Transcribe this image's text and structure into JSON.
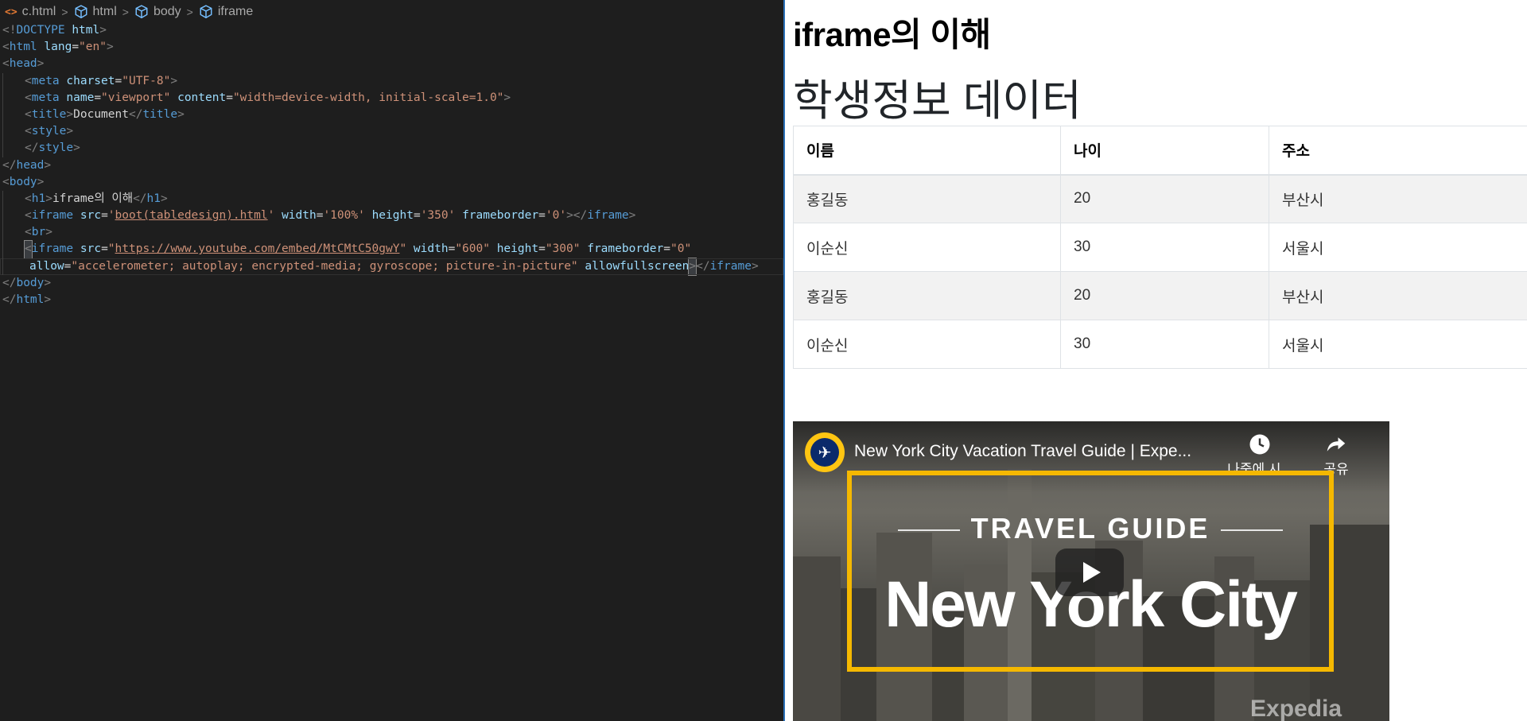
{
  "breadcrumb": {
    "file": "c.html",
    "file_icon": "<>",
    "items": [
      "html",
      "body",
      "iframe"
    ],
    "separator": ">"
  },
  "code_lines": [
    {
      "segments": [
        [
          "<!",
          "t-punc"
        ],
        [
          "DOCTYPE",
          "t-dt"
        ],
        [
          " ",
          "t-text"
        ],
        [
          "html",
          "t-attr"
        ],
        [
          ">",
          "t-punc"
        ]
      ]
    },
    {
      "segments": [
        [
          "<",
          "t-punc"
        ],
        [
          "html",
          "t-tag"
        ],
        [
          " ",
          "t-text"
        ],
        [
          "lang",
          "t-attr"
        ],
        [
          "=",
          "t-text"
        ],
        [
          "\"en\"",
          "t-str"
        ],
        [
          ">",
          "t-punc"
        ]
      ]
    },
    {
      "segments": [
        [
          "<",
          "t-punc"
        ],
        [
          "head",
          "t-tag"
        ],
        [
          ">",
          "t-punc"
        ]
      ]
    },
    {
      "indent": 1,
      "segments": [
        [
          "<",
          "t-punc"
        ],
        [
          "meta",
          "t-tag"
        ],
        [
          " ",
          "t-text"
        ],
        [
          "charset",
          "t-attr"
        ],
        [
          "=",
          "t-text"
        ],
        [
          "\"UTF-8\"",
          "t-str"
        ],
        [
          ">",
          "t-punc"
        ]
      ]
    },
    {
      "indent": 1,
      "segments": [
        [
          "<",
          "t-punc"
        ],
        [
          "meta",
          "t-tag"
        ],
        [
          " ",
          "t-text"
        ],
        [
          "name",
          "t-attr"
        ],
        [
          "=",
          "t-text"
        ],
        [
          "\"viewport\"",
          "t-str"
        ],
        [
          " ",
          "t-text"
        ],
        [
          "content",
          "t-attr"
        ],
        [
          "=",
          "t-text"
        ],
        [
          "\"width=device-width, initial-scale=1.0\"",
          "t-str"
        ],
        [
          ">",
          "t-punc"
        ]
      ]
    },
    {
      "indent": 1,
      "segments": [
        [
          "<",
          "t-punc"
        ],
        [
          "title",
          "t-tag"
        ],
        [
          ">",
          "t-punc"
        ],
        [
          "Document",
          "t-text"
        ],
        [
          "</",
          "t-punc"
        ],
        [
          "title",
          "t-tag"
        ],
        [
          ">",
          "t-punc"
        ]
      ]
    },
    {
      "indent": 1,
      "segments": [
        [
          "<",
          "t-punc"
        ],
        [
          "style",
          "t-tag"
        ],
        [
          ">",
          "t-punc"
        ]
      ]
    },
    {
      "indent": 1,
      "segments": [
        [
          "</",
          "t-punc"
        ],
        [
          "style",
          "t-tag"
        ],
        [
          ">",
          "t-punc"
        ]
      ]
    },
    {
      "segments": [
        [
          "</",
          "t-punc"
        ],
        [
          "head",
          "t-tag"
        ],
        [
          ">",
          "t-punc"
        ]
      ]
    },
    {
      "segments": [
        [
          "<",
          "t-punc"
        ],
        [
          "body",
          "t-tag"
        ],
        [
          ">",
          "t-punc"
        ]
      ]
    },
    {
      "indent": 1,
      "segments": [
        [
          "<",
          "t-punc"
        ],
        [
          "h1",
          "t-tag"
        ],
        [
          ">",
          "t-punc"
        ],
        [
          "iframe의 이해",
          "t-text"
        ],
        [
          "</",
          "t-punc"
        ],
        [
          "h1",
          "t-tag"
        ],
        [
          ">",
          "t-punc"
        ]
      ]
    },
    {
      "indent": 1,
      "segments": [
        [
          "<",
          "t-punc"
        ],
        [
          "iframe",
          "t-tag"
        ],
        [
          " ",
          "t-text"
        ],
        [
          "src",
          "t-attr"
        ],
        [
          "=",
          "t-text"
        ],
        [
          "'",
          "t-str"
        ],
        [
          "boot(tabledesign).html",
          "t-link"
        ],
        [
          "'",
          "t-str"
        ],
        [
          " ",
          "t-text"
        ],
        [
          "width",
          "t-attr"
        ],
        [
          "=",
          "t-text"
        ],
        [
          "'100%'",
          "t-str"
        ],
        [
          " ",
          "t-text"
        ],
        [
          "height",
          "t-attr"
        ],
        [
          "=",
          "t-text"
        ],
        [
          "'350'",
          "t-str"
        ],
        [
          " ",
          "t-text"
        ],
        [
          "frameborder",
          "t-attr"
        ],
        [
          "=",
          "t-text"
        ],
        [
          "'0'",
          "t-str"
        ],
        [
          "></",
          "t-punc"
        ],
        [
          "iframe",
          "t-tag"
        ],
        [
          ">",
          "t-punc"
        ]
      ]
    },
    {
      "indent": 1,
      "segments": [
        [
          "<",
          "t-punc"
        ],
        [
          "br",
          "t-tag"
        ],
        [
          ">",
          "t-punc"
        ]
      ]
    },
    {
      "indent": 1,
      "cursor": true,
      "segments": [
        [
          "<",
          "cur-mark t-punc"
        ],
        [
          "iframe",
          "t-tag"
        ],
        [
          " ",
          "t-text"
        ],
        [
          "src",
          "t-attr"
        ],
        [
          "=",
          "t-text"
        ],
        [
          "\"",
          "t-str"
        ],
        [
          "https://www.youtube.com/embed/MtCMtC50gwY",
          "t-link"
        ],
        [
          "\"",
          "t-str"
        ],
        [
          " ",
          "t-text"
        ],
        [
          "width",
          "t-attr"
        ],
        [
          "=",
          "t-text"
        ],
        [
          "\"600\"",
          "t-str"
        ],
        [
          " ",
          "t-text"
        ],
        [
          "height",
          "t-attr"
        ],
        [
          "=",
          "t-text"
        ],
        [
          "\"300\"",
          "t-str"
        ],
        [
          " ",
          "t-text"
        ],
        [
          "frameborder",
          "t-attr"
        ],
        [
          "=",
          "t-text"
        ],
        [
          "\"0\"",
          "t-str"
        ]
      ]
    },
    {
      "indent": 1,
      "wrap": true,
      "active": true,
      "segments": [
        [
          "allow",
          "t-attr"
        ],
        [
          "=",
          "t-text"
        ],
        [
          "\"accelerometer; autoplay; encrypted-media; gyroscope; picture-in-picture\"",
          "t-str"
        ],
        [
          " ",
          "t-text"
        ],
        [
          "allowfullscreen",
          "t-attr"
        ],
        [
          ">",
          "cur-mark t-punc"
        ],
        [
          "</",
          "t-punc"
        ],
        [
          "iframe",
          "t-tag"
        ],
        [
          ">",
          "t-punc"
        ]
      ]
    },
    {
      "segments": [
        [
          "</",
          "t-punc"
        ],
        [
          "body",
          "t-tag"
        ],
        [
          ">",
          "t-punc"
        ]
      ]
    },
    {
      "segments": [
        [
          "</",
          "t-punc"
        ],
        [
          "html",
          "t-tag"
        ],
        [
          ">",
          "t-punc"
        ]
      ]
    }
  ],
  "preview": {
    "heading": "iframe의 이해",
    "table_title": "학생정보 데이터",
    "table": {
      "headers": [
        "이름",
        "나이",
        "주소"
      ],
      "rows": [
        [
          "홍길동",
          "20",
          "부산시"
        ],
        [
          "이순신",
          "30",
          "서울시"
        ],
        [
          "홍길동",
          "20",
          "부산시"
        ],
        [
          "이순신",
          "30",
          "서울시"
        ]
      ]
    },
    "video": {
      "title": "New York City Vacation Travel Guide | Expe...",
      "watch_later_label": "나중에 시...",
      "share_label": "공유",
      "thumbnail_label": "TRAVEL GUIDE",
      "thumbnail_city": "New York City",
      "watermark": "Expedia",
      "channel_icon": "expedia-plane-icon",
      "accent_color": "#f5b800"
    }
  }
}
